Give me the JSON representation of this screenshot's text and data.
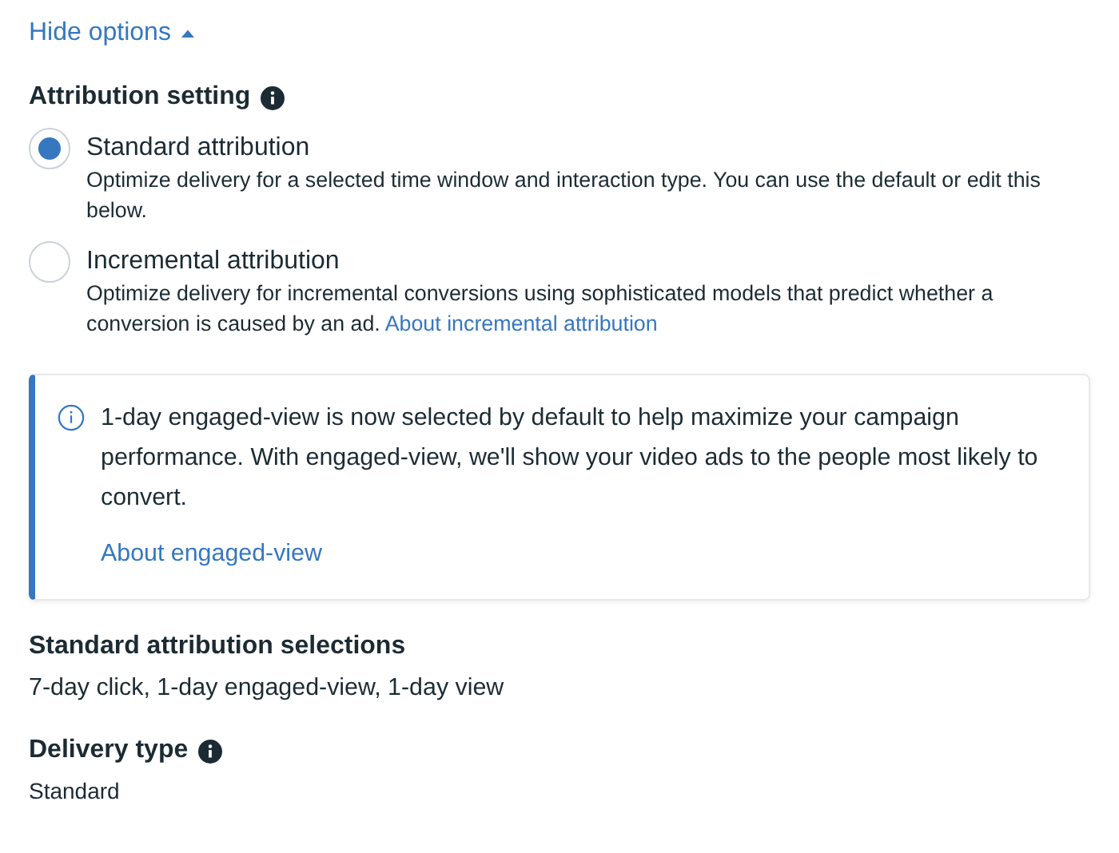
{
  "toggle": {
    "label": "Hide options",
    "expanded": true
  },
  "attribution": {
    "title": "Attribution setting",
    "options": [
      {
        "label": "Standard attribution",
        "selected": true,
        "description": "Optimize delivery for a selected time window and interaction type. You can use the default or edit this below."
      },
      {
        "label": "Incremental attribution",
        "selected": false,
        "description": "Optimize delivery for incremental conversions using sophisticated models that predict whether a conversion is caused by an ad.",
        "link": "About incremental attribution"
      }
    ]
  },
  "notice": {
    "text": "1-day engaged-view is now selected by default to help maximize your campaign performance. With engaged-view, we'll show your video ads to the people most likely to convert.",
    "link": "About engaged-view"
  },
  "selections": {
    "title": "Standard attribution selections",
    "value": "7-day click, 1-day engaged-view, 1-day view"
  },
  "delivery": {
    "title": "Delivery type",
    "value": "Standard"
  }
}
